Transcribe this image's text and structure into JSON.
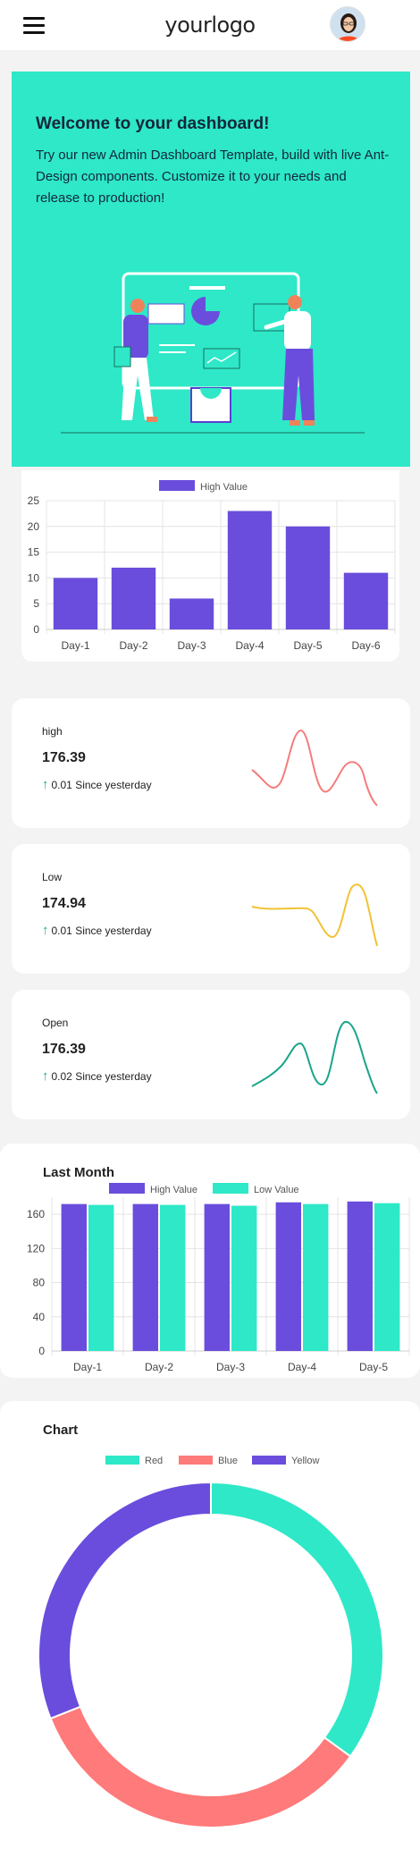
{
  "header": {
    "logo": "yourlogo"
  },
  "hero": {
    "title": "Welcome to your dashboard!",
    "text": "Try our new Admin Dashboard Template, build with live Ant-Design components. Customize it to your needs and release to production!"
  },
  "stats": [
    {
      "label": "high",
      "value": "176.39",
      "change": "0.01 Since yesterday",
      "color": "#f47c7c"
    },
    {
      "label": "Low",
      "value": "174.94",
      "change": "0.01 Since yesterday",
      "color": "#f2c233"
    },
    {
      "label": "Open",
      "value": "176.39",
      "change": "0.02 Since yesterday",
      "color": "#1aa58a"
    }
  ],
  "last_month": {
    "title": "Last Month"
  },
  "donut": {
    "title": "Chart"
  },
  "colors": {
    "accent": "#2ee8c8",
    "purple": "#6a4ddc",
    "red": "#ff7a7a",
    "teal": "#2ee8c8"
  },
  "chart_data": [
    {
      "type": "bar",
      "categories": [
        "Day-1",
        "Day-2",
        "Day-3",
        "Day-4",
        "Day-5",
        "Day-6"
      ],
      "series": [
        {
          "name": "High Value",
          "values": [
            10,
            12,
            6,
            23,
            20,
            11
          ]
        }
      ],
      "ylim": [
        0,
        25
      ],
      "yticks": [
        0,
        5,
        10,
        15,
        20,
        25
      ],
      "legend": "top"
    },
    {
      "type": "bar",
      "title": "Last Month",
      "categories": [
        "Day-1",
        "Day-2",
        "Day-3",
        "Day-4",
        "Day-5"
      ],
      "series": [
        {
          "name": "High Value",
          "values": [
            172,
            172,
            172,
            174,
            175
          ]
        },
        {
          "name": "Low Value",
          "values": [
            171,
            171,
            170,
            172,
            173
          ]
        }
      ],
      "ylim": [
        0,
        180
      ],
      "yticks": [
        0,
        40,
        80,
        120,
        160
      ],
      "legend": "top"
    },
    {
      "type": "pie",
      "title": "Chart",
      "categories": [
        "Red",
        "Blue",
        "Yellow"
      ],
      "values": [
        35,
        34,
        31
      ],
      "legend": "top"
    }
  ]
}
